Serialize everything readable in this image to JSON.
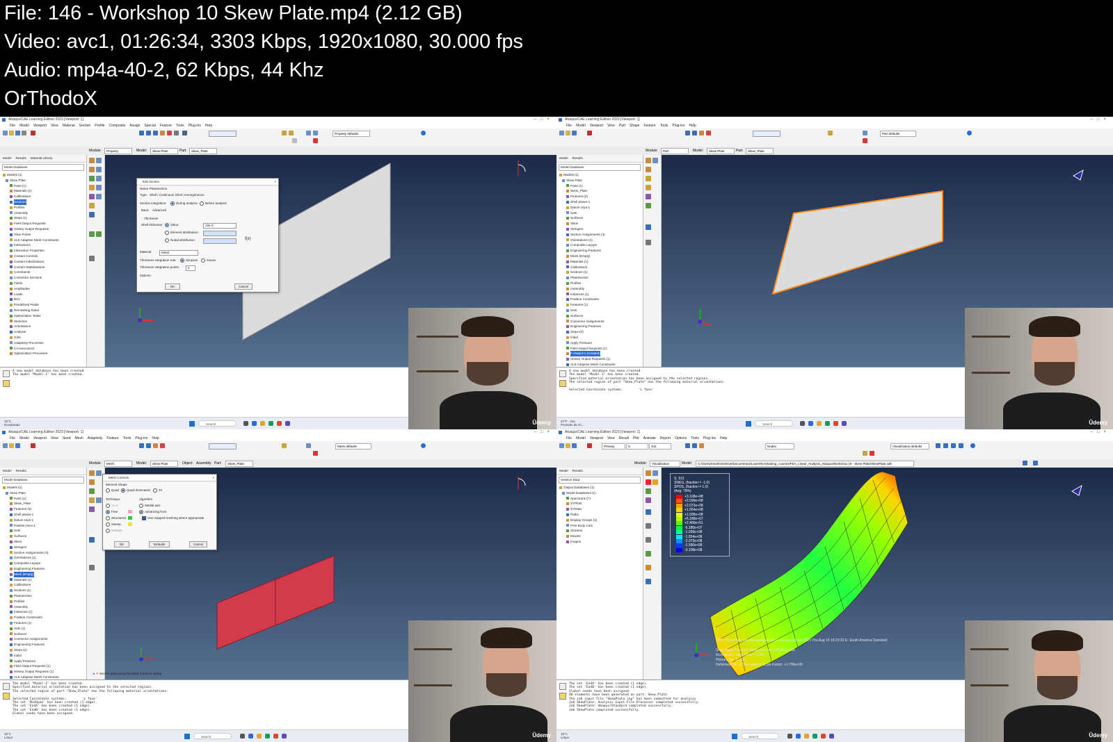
{
  "header": {
    "file_line": "File: 146 - Workshop 10 Skew Plate.mp4 (2.12 GB)",
    "video_line": "Video: avc1, 01:26:34, 3303 Kbps, 1920x1080, 30.000 fps",
    "audio_line": "Audio: mp4a-40-2, 62 Kbps, 44 Khz",
    "author_line": "OrThodoX"
  },
  "panels": [
    {
      "title": "Abaqus/CAE Learning Edition 2023 [Viewport: 1]",
      "menu": [
        "File",
        "Model",
        "Viewport",
        "View",
        "Material",
        "Section",
        "Profile",
        "Composite",
        "Assign",
        "Special",
        "Feature",
        "Tools",
        "Plug-ins",
        "Help"
      ],
      "module_label": "Module:",
      "module": "Property",
      "model_label": "Model:",
      "model": "Skew Plate",
      "part_label": "Part:",
      "part": "Skew_Plate",
      "toolbar_combo": "Property defaults",
      "tree_tabs": [
        "Model",
        "Results",
        "Material Library"
      ],
      "tree_combo": "Model Database",
      "tree": [
        "Models (1)",
        "Skew Plate",
        "Parts (1)",
        "Materials (1)",
        "Calibrations",
        "Sections",
        "Profiles",
        "Assembly",
        "Steps (1)",
        "Field Output Requests",
        "History Output Requests",
        "Time Points",
        "ALE Adaptive Mesh Constraints",
        "Interactions",
        "Interaction Properties",
        "Contact Controls",
        "Contact Initializations",
        "Contact Stabilizations",
        "Constraints",
        "Connector Sections",
        "Fields",
        "Amplitudes",
        "Loads",
        "BCs",
        "Predefined Fields",
        "Remeshing Rules",
        "Optimization Tasks",
        "Sketches",
        "Annotations",
        "Analysis",
        "Jobs",
        "Adaptivity Processes",
        "Co-executions",
        "Optimization Processes"
      ],
      "tree_highlight": "Sections",
      "dialog": {
        "title": "Edit Section",
        "name_label": "Name:",
        "name": "PlateSection",
        "type_label": "Type:",
        "type": "Shell / Continuum Shell, Homogeneous",
        "integration_label": "Section integration:",
        "integration_during": "During analysis",
        "integration_before": "Before analysis",
        "tabs": [
          "Basic",
          "Advanced"
        ],
        "thickness_group": "Thickness",
        "shell_thickness_label": "Shell thickness:",
        "value_label": "Value:",
        "value": "10e-3",
        "element_dist": "Element distribution:",
        "nodal_dist": "Nodal distribution:",
        "fx": "f(x)",
        "material_label": "Material:",
        "material": "Metal",
        "rule_label": "Thickness integration rule:",
        "rule_simpson": "Simpson",
        "rule_gauss": "Gauss",
        "points_label": "Thickness integration points:",
        "points": "5",
        "options_label": "Options:",
        "ok": "OK",
        "cancel": "Cancel"
      },
      "messages": [
        "A new model database has been created.",
        "The model \"Model-1\" has been created."
      ],
      "taskbar": {
        "weather_temp": "18°C",
        "weather_text": "Ensolarado",
        "search": "Search"
      },
      "brand": "Ûdemy"
    },
    {
      "title": "Abaqus/CAE Learning Edition 2023 [Viewport: 1]",
      "menu": [
        "File",
        "Model",
        "Viewport",
        "View",
        "Part",
        "Shape",
        "Feature",
        "Tools",
        "Plug-ins",
        "Help"
      ],
      "module_label": "Module:",
      "module": "Part",
      "model_label": "Model:",
      "model": "Skew Plate",
      "part_label": "Part:",
      "part": "Skew_Plate",
      "toolbar_combo": "Part defaults",
      "tree_tabs": [
        "Model",
        "Results"
      ],
      "tree_combo": "Model Database",
      "tree": [
        "Models (1)",
        "Skew Plate",
        "Parts (1)",
        "Skew_Plate",
        "Features (2)",
        "Shell planar-1",
        "Datum csys-1",
        "Sets",
        "Surfaces",
        "Skins",
        "Stringers",
        "Section Assignments (4)",
        "Orientations (1)",
        "Composite Layups",
        "Engineering Features",
        "Mesh (Empty)",
        "Materials (1)",
        "Calibrations",
        "Sections (1)",
        "PlateSection",
        "Profiles",
        "Assembly",
        "Instances (1)",
        "Position Constraints",
        "Features (1)",
        "Sets",
        "Surfaces",
        "Connector Assignments",
        "Engineering Features",
        "Steps (2)",
        "Initial",
        "Apply Pressure",
        "Field Output Requests (1)",
        "F-Output-1 (Created)",
        "History Output Requests (1)",
        "ALE Adaptive Mesh Constraints",
        "Interactions",
        "Loads"
      ],
      "tree_highlight": "F-Output-1 (Created)",
      "messages": [
        "A new model database has been created.",
        "The model \"Model-1\" has been created.",
        "Specified material orientation has been assigned to the selected regions.",
        "The selected region of part \"Skew_Plate\" has the following material orientations:",
        "",
        "Selected Coordinate systems:        'L fase'"
      ],
      "taskbar": {
        "weather_temp": "44°F - Ativ",
        "weather_text": "Previsão de ch...",
        "search": "Search"
      },
      "brand": "Ûdemy"
    },
    {
      "title": "Abaqus/CAE Learning Edition 2023 [Viewport: 1]",
      "menu": [
        "File",
        "Model",
        "Viewport",
        "View",
        "Seed",
        "Mesh",
        "Adaptivity",
        "Feature",
        "Tools",
        "Plug-ins",
        "Help"
      ],
      "module_label": "Module:",
      "module": "Mesh",
      "model_label": "Model:",
      "model": "Skew Plate",
      "object_label": "Object:",
      "object_assembly": "Assembly",
      "object_part": "Part:",
      "part": "Skew_Plate",
      "toolbar_combo": "Mesh defaults",
      "tree_tabs": [
        "Model",
        "Results"
      ],
      "tree_combo": "Model Database",
      "tree": [
        "Models (1)",
        "Skew Plate",
        "Parts (1)",
        "Skew_Plate",
        "Features (3)",
        "Shell planar-1",
        "Datum csys-1",
        "Partition face-1",
        "Sets",
        "Surfaces",
        "Skins",
        "Stringers",
        "Section Assignments (4)",
        "Orientations (1)",
        "Composite Layups",
        "Engineering Features",
        "Mesh (Empty)",
        "Materials (1)",
        "Calibrations",
        "Sections (1)",
        "PlateSection",
        "Profiles",
        "Assembly",
        "Instances (1)",
        "Position Constraints",
        "Features (1)",
        "Sets (1)",
        "Surfaces",
        "Connector Assignments",
        "Engineering Features",
        "Steps (2)",
        "Initial",
        "Apply Pressure",
        "Field Output Requests (1)",
        "History Output Requests (1)",
        "ALE Adaptive Mesh Constraints",
        "Interactions",
        "Loads (1)"
      ],
      "tree_highlight": "Mesh (Empty)",
      "dialog": {
        "title": "Mesh Controls",
        "shape_group": "Element Shape",
        "shape_quad": "Quad",
        "shape_quad_dominated": "Quad-dominated",
        "shape_tri": "Tri",
        "technique_group": "Technique",
        "tech_as_is": "As is",
        "tech_free": "Free",
        "tech_structured": "Structured",
        "tech_sweep": "Sweep",
        "tech_multiple": "Multiple",
        "algorithm_group": "Algorithm",
        "alg_medial": "Medial axis",
        "alg_advancing": "Advancing front",
        "alg_mapped": "Use mapped meshing where appropriate",
        "ok": "OK",
        "defaults": "Defaults",
        "cancel": "Cancel"
      },
      "prompt": "Set the data using the Mesh Controls dialog",
      "messages": [
        "The model \"Model-1\" has been created.",
        "Specified material orientation has been assigned to the selected regions.",
        "The selected region of part \"Skew_Plate\" has the following material orientations:",
        "",
        "Selected Coordinate systems:        'L fase'",
        "The set 'MidSpan' has been created (1 edge).",
        "The set 'EndA' has been created (1 edge).",
        "The set 'EndB' has been created (1 edge).",
        "Global seeds have been assigned."
      ],
      "taskbar": {
        "weather_temp": "18°C",
        "weather_text": "Limpo",
        "search": "Search"
      },
      "brand": "Ûdemy"
    },
    {
      "title": "Abaqus/CAE Learning Edition 2023 [Viewport: 1]",
      "menu": [
        "File",
        "Model",
        "Viewport",
        "View",
        "Result",
        "Plot",
        "Animate",
        "Report",
        "Options",
        "Tools",
        "Plug-ins",
        "Help"
      ],
      "module_label": "Module:",
      "module": "Visualization",
      "model_label": "Model:",
      "model": "C:/Users/renat/OneDrive/Documentos/LearnFEA/training_courses/FEA_Linear_Analysis_Abaqus/Workshop 10 - Skew Plate/SkewPlate.odb",
      "field_primary": "Primary",
      "field_s": "S",
      "field_s11": "S11",
      "toolbar_combo": "Visualization defaults",
      "select_combo": "Nodes",
      "tree_tabs": [
        "Model",
        "Results"
      ],
      "tree_combo": "Session Data",
      "tree": [
        "Output Databases (1)",
        "Model Databases (1)",
        "Spectrums (7)",
        "XYPlots",
        "XYData",
        "Paths",
        "Display Groups (1)",
        "Free Body Cuts",
        "Streams",
        "Movies",
        "Images"
      ],
      "tree_highlight": "",
      "legend": {
        "header_lines": [
          "S, S11",
          "SNEG, (fraction = -1.0)",
          "SPOS, (fraction = 1.0)",
          "(Avg: 75%)"
        ],
        "values": [
          "+3.108e+08",
          "+2.590e+08",
          "+2.072e+08",
          "+1.554e+08",
          "+1.036e+08",
          "+5.180e+07",
          "+2.400e+01",
          "-5.180e+07",
          "-1.036e+08",
          "-1.554e+08",
          "-2.072e+08",
          "-2.590e+08",
          "-3.108e+08"
        ],
        "colors": [
          "#ff0000",
          "#ff5a00",
          "#ffa000",
          "#ffd500",
          "#e8ff00",
          "#a8ff00",
          "#55ff00",
          "#00ff3c",
          "#00ff9c",
          "#00e4ff",
          "#0092ff",
          "#0040ff",
          "#0000ff"
        ]
      },
      "viewport_info": {
        "odb_line": "ODB: SkewPlate.odb    Abaqus/Standard Learning Edition 2023    Thu Aug 15 18:23:32 E. South America Standard",
        "step_line": "Step: Apply Pressure, Apply pressure (20 kPa) load",
        "increment_line": "Increment      1: Step Time =    1.000",
        "primary_line": "Primary Var: S, S11",
        "deformed_line": "Deformed Var: U   Deformation Scale Factor: +1.795e+00"
      },
      "messages": [
        "The set 'EndA' has been created (1 edge).",
        "The set 'EndB' has been created (1 edge).",
        "Global seeds have been assigned.",
        "40 elements have been generated on part: Skew_Plate",
        "The job input file \"SkewPlate.inp\" has been submitted for analysis.",
        "Job SkewPlate: Analysis Input File Processor completed successfully.",
        "Job SkewPlate: Abaqus/Standard completed successfully.",
        "Job SkewPlate completed successfully."
      ],
      "taskbar": {
        "weather_temp": "18°C",
        "weather_text": "Limpo",
        "search": "Search"
      },
      "brand": "Ûdemy"
    }
  ]
}
